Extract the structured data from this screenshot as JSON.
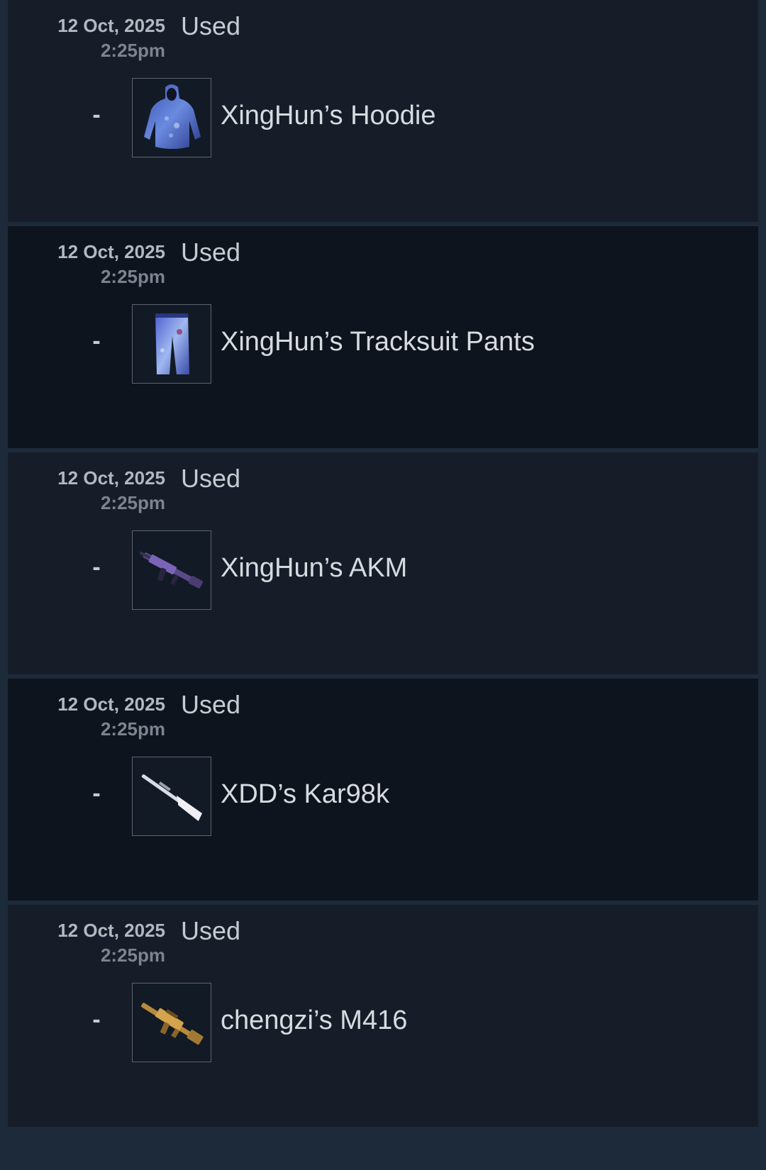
{
  "history": {
    "rows": [
      {
        "date": "12 Oct, 2025",
        "time": "2:25pm",
        "status": "Used",
        "quantity": "-",
        "item_name": "XingHun’s Hoodie",
        "icon": "hoodie-icon",
        "shade": "light"
      },
      {
        "date": "12 Oct, 2025",
        "time": "2:25pm",
        "status": "Used",
        "quantity": "-",
        "item_name": "XingHun’s Tracksuit Pants",
        "icon": "pants-icon",
        "shade": "dark"
      },
      {
        "date": "12 Oct, 2025",
        "time": "2:25pm",
        "status": "Used",
        "quantity": "-",
        "item_name": "XingHun’s AKM",
        "icon": "rifle-icon",
        "shade": "light"
      },
      {
        "date": "12 Oct, 2025",
        "time": "2:25pm",
        "status": "Used",
        "quantity": "-",
        "item_name": "XDD’s Kar98k",
        "icon": "sniper-rifle-icon",
        "shade": "dark"
      },
      {
        "date": "12 Oct, 2025",
        "time": "2:25pm",
        "status": "Used",
        "quantity": "-",
        "item_name": "chengzi’s M416",
        "icon": "assault-rifle-icon",
        "shade": "light"
      }
    ]
  },
  "colors": {
    "background": "#1d2a3a",
    "row_light": "#161d29",
    "row_dark": "#0e141d",
    "text_primary": "#d7dbe0",
    "text_muted": "#7c8490"
  }
}
